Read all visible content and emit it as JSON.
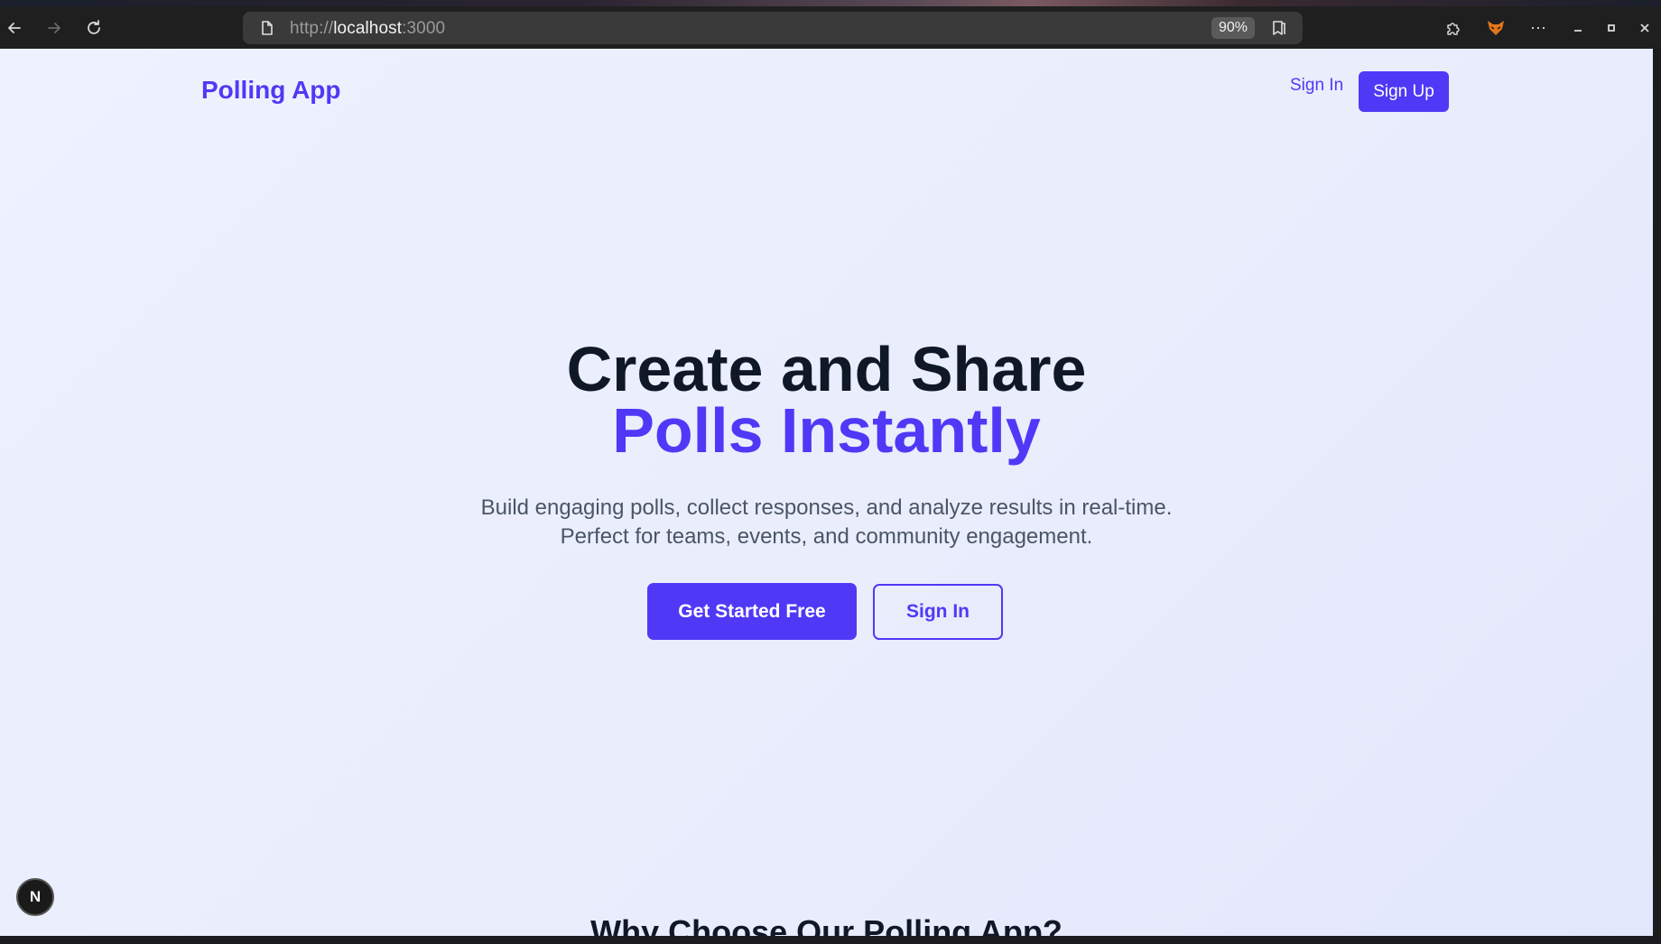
{
  "browser": {
    "url_scheme": "http://",
    "url_host": "localhost",
    "url_port": ":3000",
    "zoom": "90%",
    "icons": {
      "back": "arrow-left-icon",
      "forward": "arrow-right-icon",
      "reload": "reload-icon",
      "page": "document-icon",
      "reader": "reader-mode-icon",
      "extensions": "puzzle-icon",
      "profile": "fox-icon",
      "menu": "more-icon",
      "minimize": "minimize-icon",
      "maximize": "maximize-icon",
      "close": "close-icon"
    }
  },
  "page": {
    "header": {
      "logo": "Polling App",
      "sign_in": "Sign In",
      "sign_up": "Sign Up"
    },
    "hero": {
      "title_line1": "Create and Share",
      "title_line2": "Polls Instantly",
      "subtitle_line1": "Build engaging polls, collect responses, and analyze results in real-time.",
      "subtitle_line2": "Perfect for teams, events, and community engagement.",
      "cta_primary": "Get Started Free",
      "cta_secondary": "Sign In"
    },
    "features_heading": "Why Choose Our Polling App?",
    "dev_badge": "N"
  },
  "colors": {
    "accent": "#4f39f6",
    "heading": "#101828",
    "body_text": "#4a5565",
    "background": "#eef2ff"
  }
}
